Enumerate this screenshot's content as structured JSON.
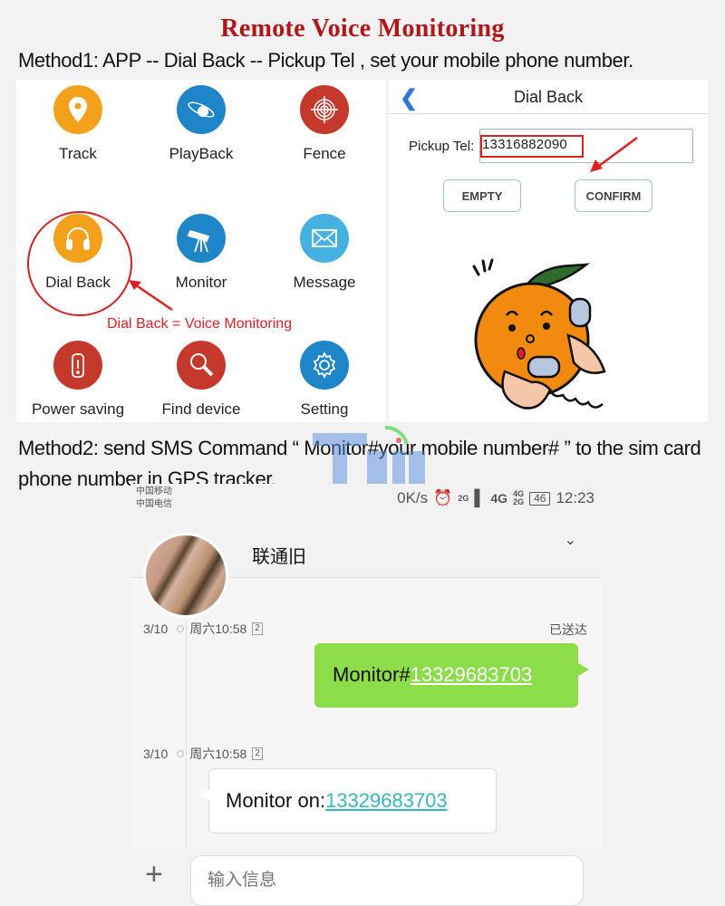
{
  "title": "Remote Voice Monitoring",
  "method1": "Method1: APP -- Dial Back -- Pickup Tel , set your mobile phone number.",
  "app_grid": {
    "items": [
      {
        "label": "Track",
        "icon": "location-pin-icon",
        "color": "#f3a01a"
      },
      {
        "label": "PlayBack",
        "icon": "orbit-icon",
        "color": "#1e86c8"
      },
      {
        "label": "Fence",
        "icon": "target-icon",
        "color": "#c4392b"
      },
      {
        "label": "Dial Back",
        "icon": "headphones-icon",
        "color": "#f3a01a"
      },
      {
        "label": "Monitor",
        "icon": "telescope-icon",
        "color": "#1e86c8"
      },
      {
        "label": "Message",
        "icon": "envelope-icon",
        "color": "#45b1e0"
      },
      {
        "label": "Power saving",
        "icon": "battery-icon",
        "color": "#c4392b"
      },
      {
        "label": "Find device",
        "icon": "magnifier-icon",
        "color": "#c4392b"
      },
      {
        "label": "Setting",
        "icon": "gear-icon",
        "color": "#1e86c8"
      }
    ],
    "annotation": "Dial Back = Voice Monitoring"
  },
  "dial_back": {
    "title": "Dial Back",
    "pickup_label": "Pickup Tel:",
    "pickup_value": "13316882090",
    "empty_button": "EMPTY",
    "confirm_button": "CONFIRM"
  },
  "method2": "Method2: send SMS Command “ Monitor#your mobile number# ” to the sim card phone number in GPS tracker.",
  "phone": {
    "carrier1": "中国移动",
    "carrier2": "中国电信",
    "speed": "0K/s",
    "net1": "2G",
    "net2": "4G",
    "net3": "4G",
    "net4": "2G",
    "battery": "46",
    "time": "12:23",
    "contact": "联通旧",
    "messages": [
      {
        "date": "3/10",
        "time": "周六10:58",
        "sim": "2",
        "status": "已送达",
        "prefix": "Monitor#",
        "number": "13329683703",
        "direction": "sent"
      },
      {
        "date": "3/10",
        "time": "周六10:58",
        "sim": "2",
        "prefix": "Monitor on:",
        "number": "13329683703",
        "direction": "received"
      }
    ],
    "input_placeholder": "输入信息"
  }
}
